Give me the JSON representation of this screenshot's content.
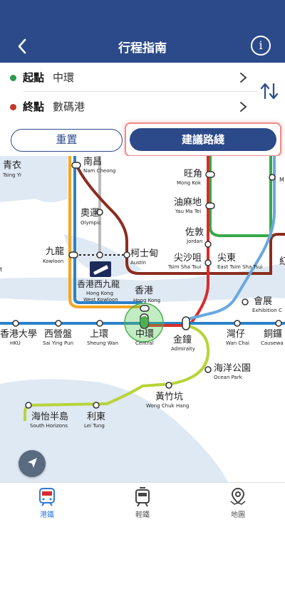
{
  "header": {
    "title": "行程指南"
  },
  "route": {
    "origin": {
      "label": "起點",
      "value": "中環",
      "color": "#2e9a4a"
    },
    "destination": {
      "label": "終點",
      "value": "數碼港",
      "color": "#c0392b"
    }
  },
  "actions": {
    "reset_label": "重置",
    "suggest_label": "建議路綫"
  },
  "map": {
    "stations": {
      "tsing_yi_zh": "青衣",
      "tsing_yi_en": "Tsing Yi",
      "nam_cheong_zh": "南昌",
      "nam_cheong_en": "Nam Cheong",
      "olympic_zh": "奧運",
      "olympic_en": "Olympic",
      "kowloon_zh": "九龍",
      "kowloon_en": "Kowloon",
      "austin_zh": "柯士甸",
      "austin_en": "Austin",
      "hkwk_zh": "香港西九龍",
      "hkwk_en1": "Hong Kong",
      "hkwk_en2": "West Kowloon",
      "hk_zh": "香港",
      "hk_en": "Hong Kong",
      "mong_kok_zh": "旺角",
      "mong_kok_en": "Mong Kok",
      "yau_ma_tei_zh": "油麻地",
      "yau_ma_tei_en": "Yau Ma Tei",
      "jordan_zh": "佐敦",
      "jordan_en": "Jordan",
      "tst_zh": "尖沙咀",
      "tst_en": "Tsim Sha Tsui",
      "etst_zh": "尖東",
      "etst_en": "East Tsim Sha Tsui",
      "exhibition_zh": "會展",
      "exhibition_en": "Exhibition C",
      "hku_zh": "香港大學",
      "hku_en": "HKU",
      "syp_zh": "西營盤",
      "syp_en": "Sai Ying Pun",
      "sheung_wan_zh": "上環",
      "sheung_wan_en": "Sheung Wan",
      "central_zh": "中環",
      "central_en": "Central",
      "admiralty_zh": "金鐘",
      "admiralty_en": "Admiralty",
      "wan_chai_zh": "灣仔",
      "wan_chai_en": "Wan Chai",
      "causeway_zh": "銅鑼",
      "causeway_en": "Causewa",
      "ocean_park_zh": "海洋公園",
      "ocean_park_en": "Ocean Park",
      "wch_zh": "黃竹坑",
      "wch_en": "Wong Chuk Hang",
      "lei_tung_zh": "利東",
      "lei_tung_en": "Lei Tung",
      "south_horizons_zh": "海怡半島",
      "south_horizons_en": "South Horizons",
      "mong_kok_east_cut": "M",
      "edge_cut_t": "t",
      "edge_cut_zh": "紅"
    }
  },
  "tabs": [
    {
      "label": "港鐵",
      "icon": "train-icon",
      "active": true
    },
    {
      "label": "輕鐵",
      "icon": "light-rail-icon",
      "active": false
    },
    {
      "label": "地圖",
      "icon": "map-pin-icon",
      "active": false
    }
  ],
  "colors": {
    "primary": "#2c4a8a",
    "active_tab": "#2c7bd8",
    "highlight_border": "#f08a8a"
  }
}
